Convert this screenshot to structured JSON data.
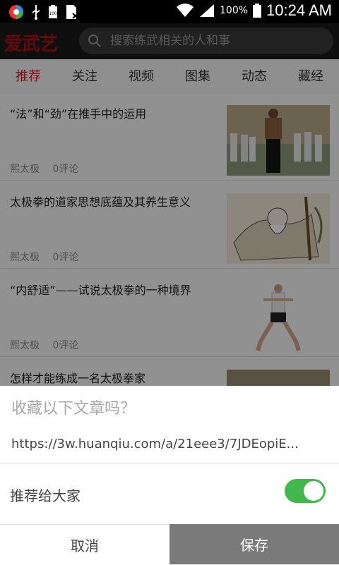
{
  "status_bar": {
    "battery_percent": "100%",
    "time": "10:24 AM",
    "icons": [
      "app-circle-icon",
      "usb-icon",
      "battery-100-icon",
      "sim-icon",
      "wifi-icon",
      "signal-icon",
      "battery-icon"
    ]
  },
  "header": {
    "logo": "爱武艺",
    "search_placeholder": "搜索练武相关的人和事"
  },
  "tabs": [
    {
      "label": "推荐",
      "active": true
    },
    {
      "label": "关注"
    },
    {
      "label": "视频"
    },
    {
      "label": "图集"
    },
    {
      "label": "动态"
    },
    {
      "label": "藏经"
    }
  ],
  "feed": [
    {
      "title": "“法”和“劲”在推手中的运用",
      "author": "熙太极",
      "comments": "0评论"
    },
    {
      "title": "太极拳的道家思想底蕴及其养生意义",
      "author": "熙太极",
      "comments": "0评论"
    },
    {
      "title": "“内舒适”——试说太极拳的一种境界",
      "author": "熙太极",
      "comments": "0评论"
    },
    {
      "title": "怎样才能练成一名太极拳家"
    }
  ],
  "dialog": {
    "title": "收藏以下文章吗？",
    "url": "https://3w.huanqiu.com/a/21eee3/7JDEopiE...",
    "recommend_label": "推荐给大家",
    "recommend_on": true,
    "cancel": "取消",
    "save": "保存"
  },
  "colors": {
    "accent_red": "#c61c1c",
    "toggle_green": "#40b84b",
    "save_gray": "#7a7a7a"
  }
}
